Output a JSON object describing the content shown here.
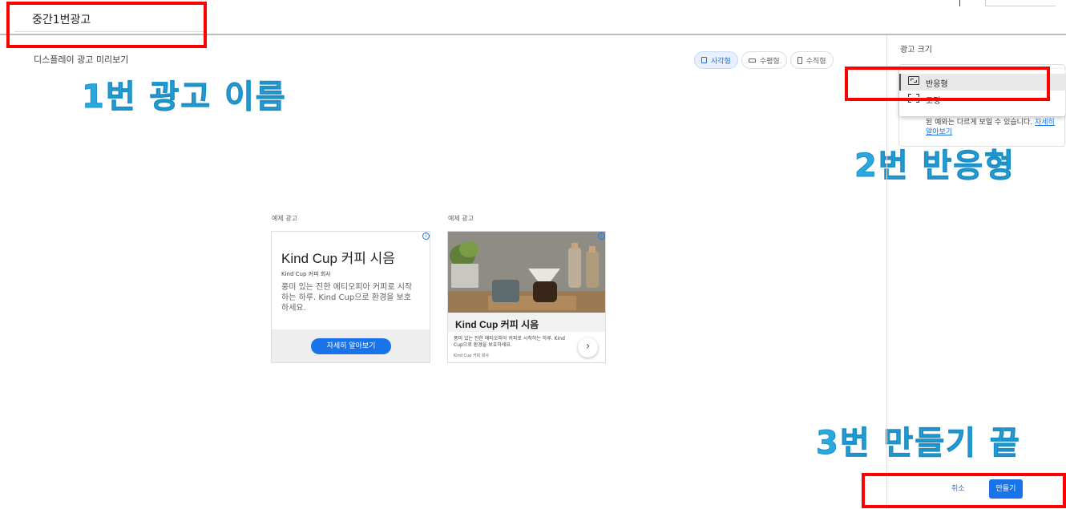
{
  "ad_name": "중간1번광고",
  "preview": {
    "title": "디스플레이 광고 미리보기",
    "toggles": [
      "사각형",
      "수평형",
      "수직형"
    ]
  },
  "annotations": {
    "one": "1번 광고 이름",
    "two": "2번 반응형",
    "three": "3번 만들기 끝"
  },
  "cards": {
    "label": "예제 광고",
    "headline": "Kind Cup 커피 시음",
    "company": "Kind Cup 커피 회사",
    "desc1": "풍미 있는 진한 에티오피아 커피로 시작하는 하루. Kind Cup으로 환경을 보호하세요.",
    "cta": "자세히 알아보기",
    "desc2": "풍미 있는 진한 에티오피아 커피로 시작하는 하루. Kind Cup으로 환경을 보호하세요.",
    "info_icon": "i",
    "next_icon": "›"
  },
  "panel": {
    "title": "광고 크기",
    "options": [
      "반응형",
      "고정"
    ],
    "note": "된 예와는 다르게 보일 수 있습니다.",
    "note_link": "자세히 알아보기"
  },
  "footer": {
    "cancel": "취소",
    "create": "만들기"
  },
  "colors": {
    "accent": "#1a73e8",
    "annotation": "#29a9e0",
    "highlight_box": "#ff0000"
  }
}
